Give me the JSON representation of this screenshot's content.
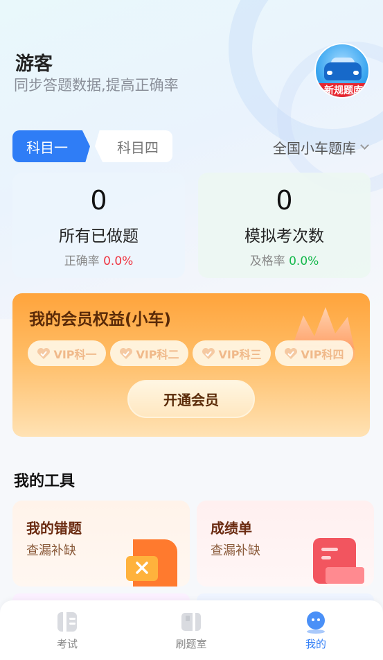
{
  "header": {
    "user_name": "游客",
    "user_sub": "同步答题数据,提高正确率",
    "avatar_ribbon": "新规题库"
  },
  "tabs": {
    "active": "科目一",
    "inactive": "科目四"
  },
  "bank_select": "全国小车题库",
  "stats": {
    "done": {
      "value": "0",
      "label": "所有已做题",
      "sub_label": "正确率",
      "sub_value": "0.0%"
    },
    "mock": {
      "value": "0",
      "label": "模拟考次数",
      "sub_label": "及格率",
      "sub_value": "0.0%"
    }
  },
  "vip": {
    "title": "我的会员权益(小车)",
    "chips": [
      "VIP科一",
      "VIP科二",
      "VIP科三",
      "VIP科四"
    ],
    "open_button": "开通会员"
  },
  "tools": {
    "title": "我的工具",
    "items": [
      {
        "name": "我的错题",
        "desc": "查漏补缺",
        "icon": "wrong-questions-icon"
      },
      {
        "name": "成绩单",
        "desc": "查漏补缺",
        "icon": "score-sheet-icon"
      }
    ]
  },
  "nav": {
    "items": [
      {
        "label": "考试",
        "icon": "exam-icon"
      },
      {
        "label": "刷题室",
        "icon": "practice-room-icon"
      },
      {
        "label": "我的",
        "icon": "profile-icon"
      }
    ],
    "active_index": 2
  },
  "colors": {
    "primary": "#2f7df6",
    "rate_red": "#ef3340",
    "rate_green": "#14b84b",
    "vip_orange": "#ffa43c"
  }
}
